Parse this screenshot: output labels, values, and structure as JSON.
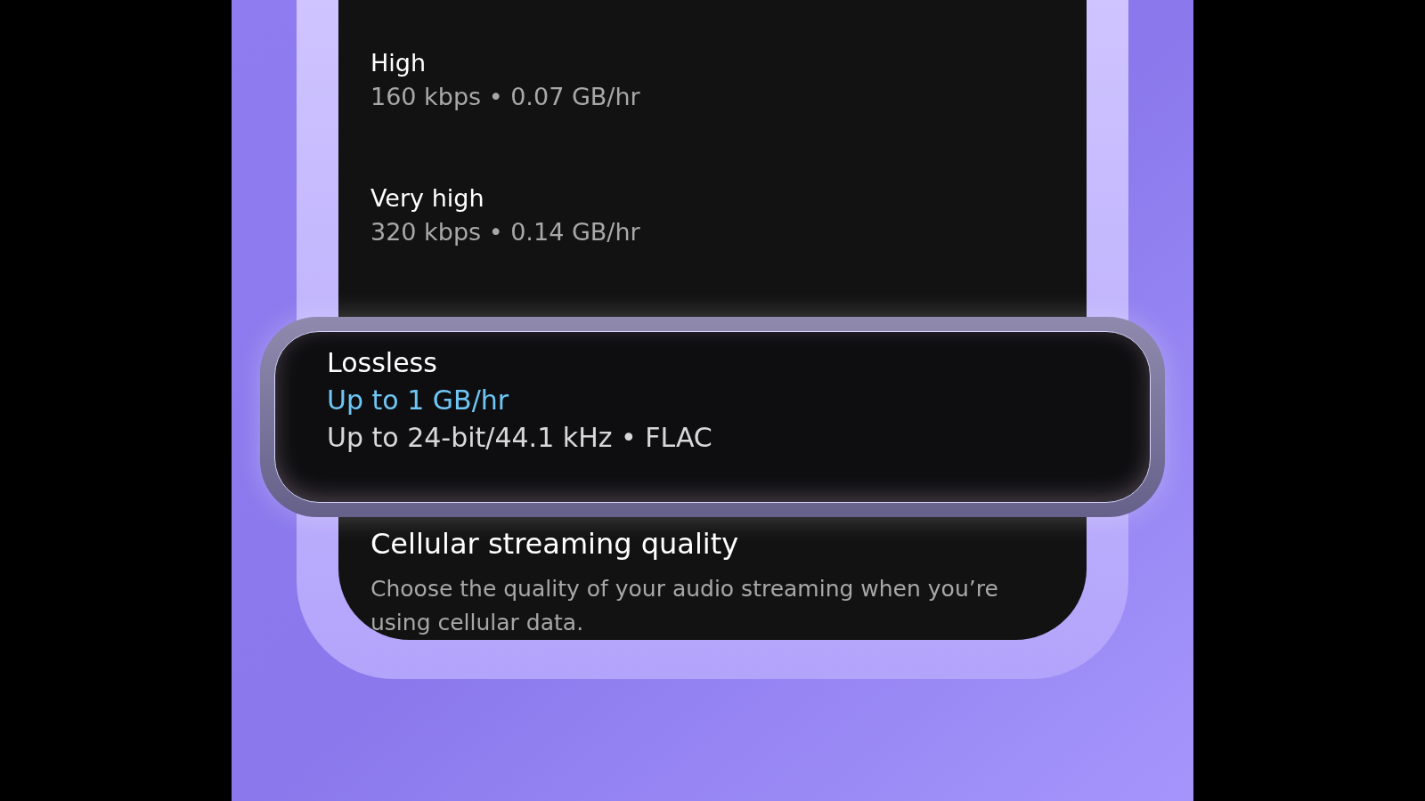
{
  "options": [
    {
      "title": "High",
      "detail": "160 kbps • 0.07 GB/hr",
      "selected": false
    },
    {
      "title": "Very high",
      "detail": "320 kbps • 0.14 GB/hr",
      "selected": false
    },
    {
      "title": "Lossless",
      "highlight": "Up to 1 GB/hr",
      "detail": "Up to 24-bit/44.1 kHz • FLAC",
      "selected": true
    }
  ],
  "section": {
    "title": "Cellular streaming quality",
    "description": "Choose the quality of your audio streaming when you’re using cellular data."
  }
}
